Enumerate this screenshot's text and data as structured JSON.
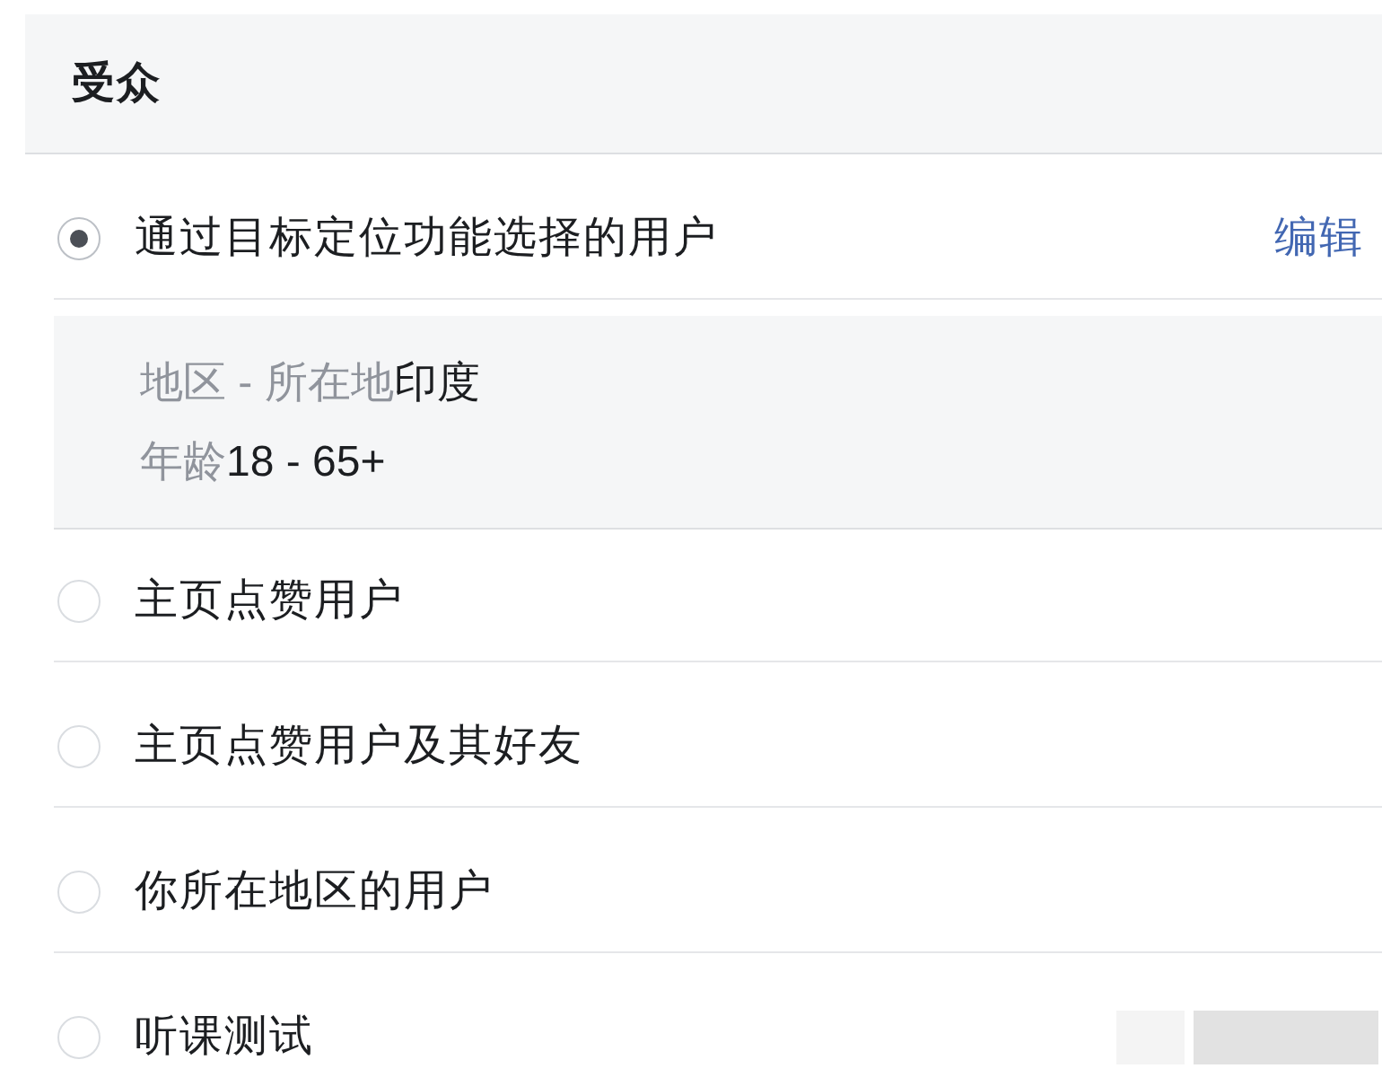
{
  "section": {
    "title": "受众"
  },
  "options": [
    {
      "label": "通过目标定位功能选择的用户",
      "selected": true,
      "action": "编辑",
      "obscured": false,
      "details": [
        {
          "label": "地区 - 所在地",
          "value": "印度"
        },
        {
          "label": "年龄",
          "value": "18 - 65+"
        }
      ]
    },
    {
      "label": "主页点赞用户",
      "selected": false,
      "obscured": false
    },
    {
      "label": "主页点赞用户及其好友",
      "selected": false,
      "obscured": false
    },
    {
      "label": "你所在地区的用户",
      "selected": false,
      "obscured": false
    },
    {
      "label": "听课测试",
      "selected": false,
      "obscured": true
    }
  ]
}
